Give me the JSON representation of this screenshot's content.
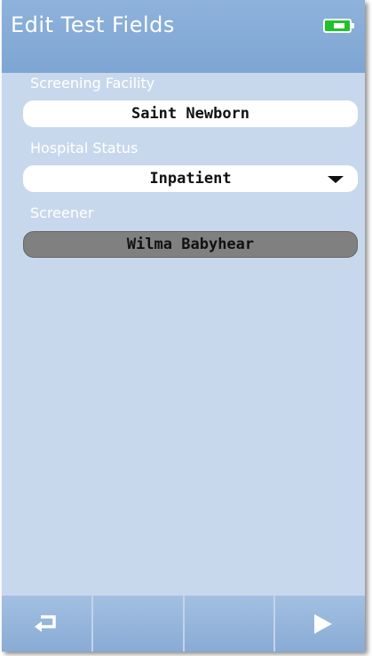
{
  "header": {
    "title": "Edit Test Fields",
    "battery_icon": "battery-charging-icon",
    "battery_color": "#1fc228"
  },
  "fields": {
    "facility": {
      "label": "Screening Facility",
      "value": "Saint Newborn"
    },
    "status": {
      "label": "Hospital Status",
      "value": "Inpatient",
      "icon": "chevron-down-icon"
    },
    "screener": {
      "label": "Screener",
      "value": "Wilma Babyhear"
    }
  },
  "footer": {
    "buttons": [
      {
        "icon": "return-icon"
      },
      {
        "icon": ""
      },
      {
        "icon": ""
      },
      {
        "icon": "play-icon"
      }
    ]
  },
  "colors": {
    "background": "#c8d8ec",
    "header": "#7ea5d3",
    "disabled_field": "#808080"
  }
}
